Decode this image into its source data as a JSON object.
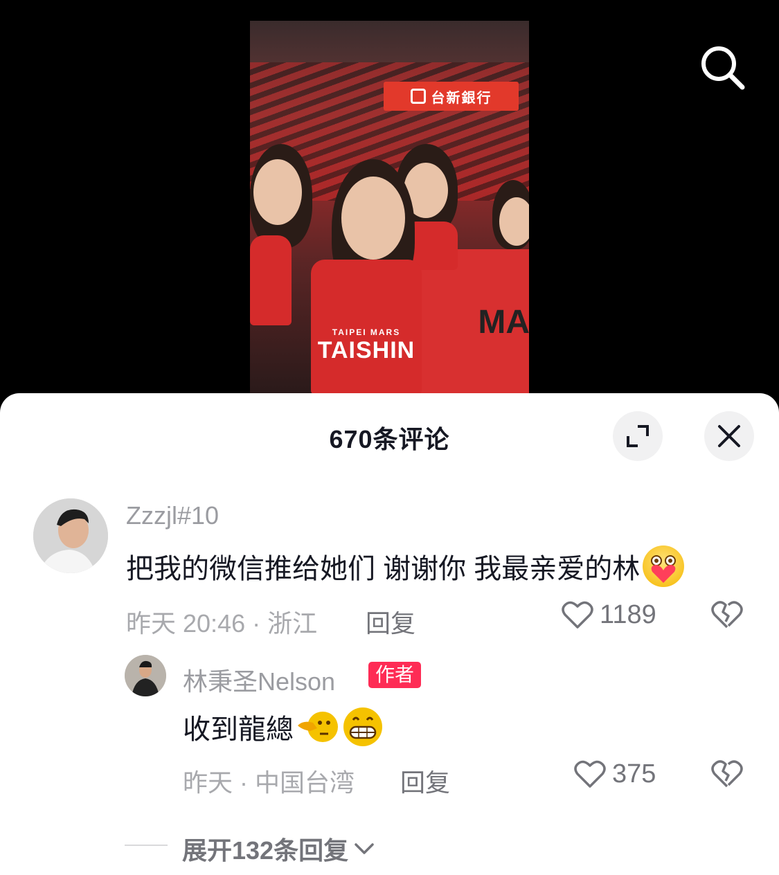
{
  "video": {
    "banner_text": "台新銀行",
    "jersey_team": "TAIPEI MARS",
    "jersey_name": "TAISHIN",
    "flag_text": "MA"
  },
  "sheet": {
    "title": "670条评论"
  },
  "comments": [
    {
      "username": "Zzzjl#10",
      "text": "把我的微信推给她们 谢谢你 我最亲爱的林",
      "meta": "昨天 20:46 · 浙江",
      "reply_label": "回复",
      "likes": "1189"
    }
  ],
  "reply_comment": {
    "username": "林秉圣Nelson",
    "badge": "作者",
    "text": "收到龍總",
    "meta": "昨天 · 中国台湾",
    "reply_label": "回复",
    "likes": "375"
  },
  "expand": {
    "label": "展开132条回复"
  },
  "colors": {
    "accent": "#fe2c55",
    "text_primary": "#161823",
    "text_secondary": "#a8a9ad"
  }
}
